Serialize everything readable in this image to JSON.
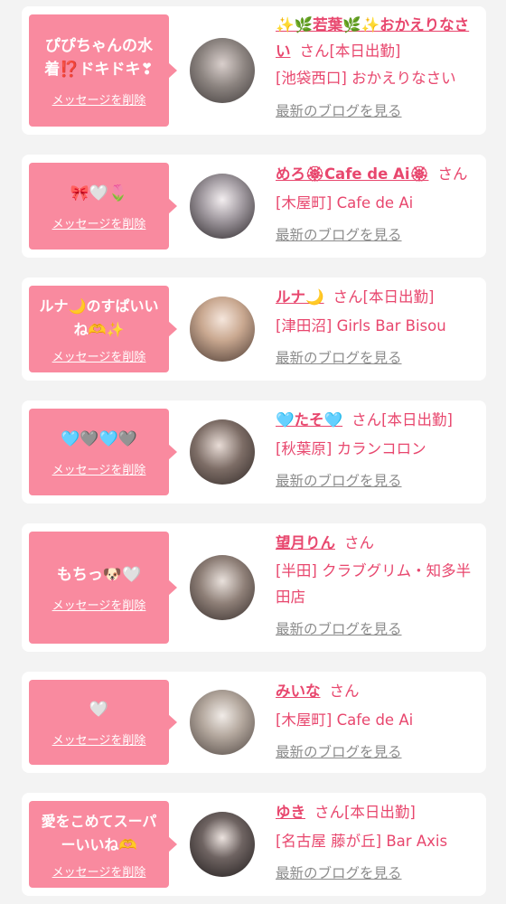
{
  "common": {
    "delete_label": "メッセージを削除",
    "blog_label": "最新のブログを見る",
    "san": "さん"
  },
  "cards": [
    {
      "message": "ぴぴちゃんの水着⁉️ドキドキ❣",
      "name": "✨🌿若葉🌿✨おかえりなさい",
      "status": "[本日出勤]",
      "shop": "[池袋西口] おかえりなさい"
    },
    {
      "message": "🎀🤍🌷",
      "name": "めろ🏵Cafe de Ai🏵",
      "status": "",
      "shop": "[木屋町] Cafe de Ai"
    },
    {
      "message": "ルナ🌙のすぱいいね🫶✨",
      "name": "ルナ🌙",
      "status": "[本日出勤]",
      "shop": "[津田沼] Girls Bar Bisou"
    },
    {
      "message": "🩵🩶🩵🩶",
      "name": "🩵たそ🩵",
      "status": "[本日出勤]",
      "shop": "[秋葉原] カランコロン"
    },
    {
      "message": "もちっ🐶🤍",
      "name": "望月りん",
      "status": "",
      "shop": "[半田] クラブグリム・知多半田店"
    },
    {
      "message": "🤍",
      "name": "みいな",
      "status": "",
      "shop": "[木屋町] Cafe de Ai"
    },
    {
      "message": "愛をこめてスーパーいいね🫶",
      "name": "ゆき",
      "status": "[本日出勤]",
      "shop": "[名古屋 藤が丘] Bar Axis"
    }
  ],
  "colors": {
    "bubble": "#f98a9f",
    "accent": "#e8476e",
    "muted": "#8c8c8c",
    "background": "#f3f3f3"
  }
}
